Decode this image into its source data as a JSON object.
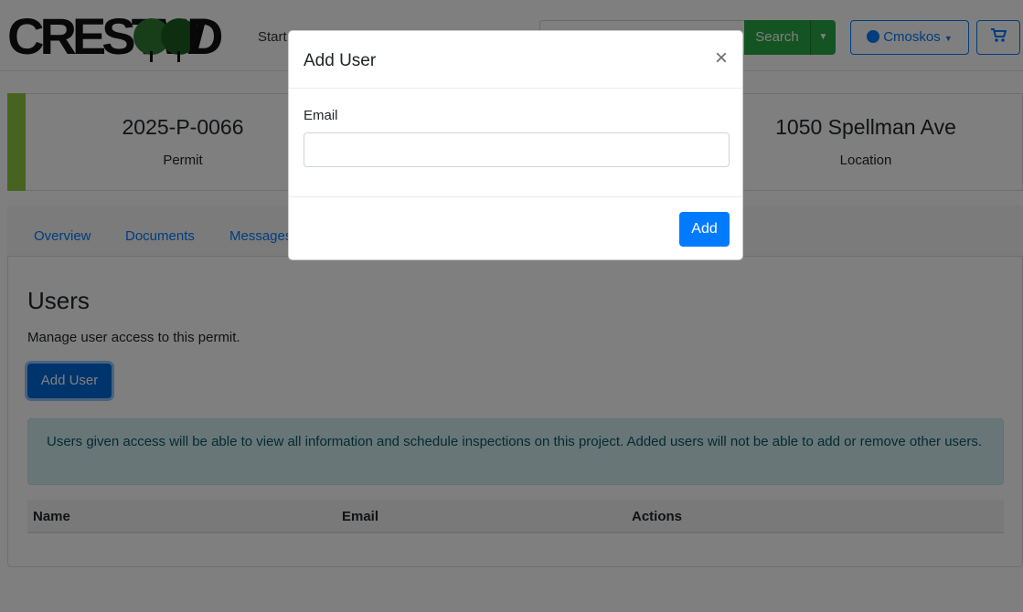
{
  "brand": {
    "logo_left": "CRESTW",
    "logo_right": "D"
  },
  "nav": {
    "start_label": "Start",
    "search_label": "Search",
    "user_label": "Cmoskos"
  },
  "permit": {
    "number": "2025-P-0066",
    "number_label": "Permit",
    "location": "1050 Spellman Ave",
    "location_label": "Location"
  },
  "tabs": [
    {
      "label": "Overview"
    },
    {
      "label": "Documents"
    },
    {
      "label": "Messages"
    }
  ],
  "users": {
    "title": "Users",
    "description": "Manage user access to this permit.",
    "add_button": "Add User",
    "alert": "Users given access will be able to view all information and schedule inspections on this project. Added users will not be able to add or remove other users.",
    "columns": [
      "Name",
      "Email",
      "Actions"
    ]
  },
  "modal": {
    "title": "Add User",
    "close_symbol": "×",
    "email_label": "Email",
    "email_value": "",
    "submit_label": "Add"
  },
  "colors": {
    "accent": "#8dc63f",
    "primary": "#007bff",
    "success": "#28a745",
    "info_bg": "#d1ecf1",
    "info_text": "#0c5460"
  },
  "icons": [
    "user-circle-icon",
    "caret-down-icon",
    "cart-icon",
    "close-icon"
  ]
}
